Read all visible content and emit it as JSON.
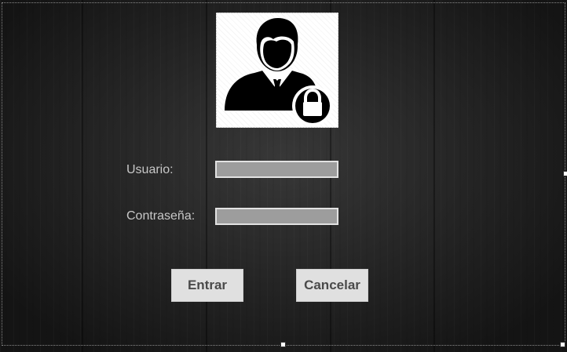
{
  "login_form": {
    "user_label": "Usuario:",
    "user_value": "",
    "password_label": "Contraseña:",
    "password_value": "",
    "enter_button": "Entrar",
    "cancel_button": "Cancelar",
    "avatar_icon": "user-lock-icon"
  },
  "colors": {
    "background": "#252525",
    "label_text": "#c8c8c8",
    "field_fill": "#9d9d9d",
    "button_fill": "#e0e0e0",
    "button_text": "#4a4a4a"
  }
}
